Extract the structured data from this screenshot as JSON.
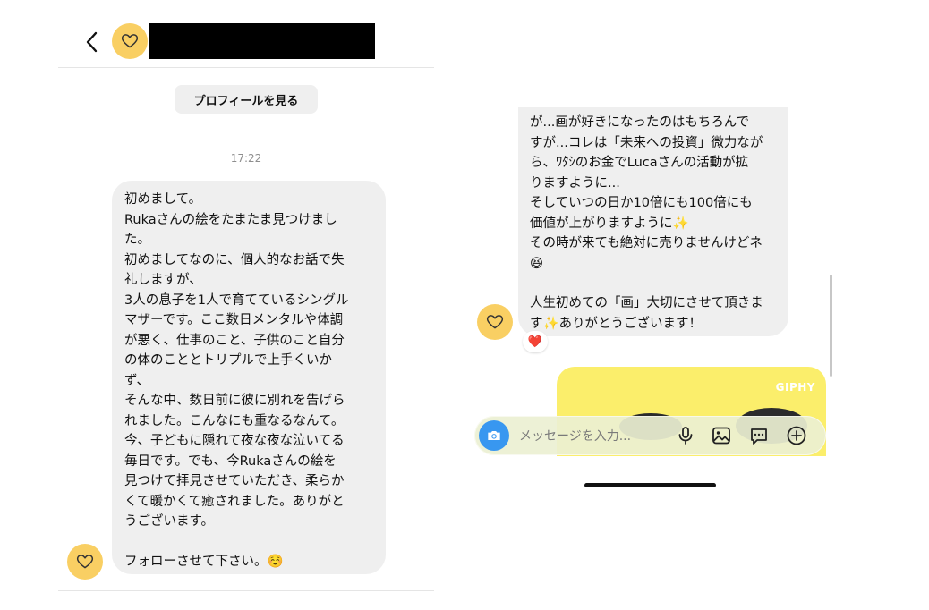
{
  "left_panel": {
    "profile_button_label": "プロフィールを見る",
    "timestamp": "17:22",
    "message_lines": [
      "初めまして。",
      "Rukaさんの絵をたまたま見つけまし\nた。",
      "初めましてなのに、個人的なお話で失\n礼しますが、",
      "3人の息子を1人で育てているシングル\nマザーです。ここ数日メンタルや体調\nが悪く、仕事のこと、子供のこと自分\nの体のこととトリプルで上手くいか\nず、",
      "そんな中、数日前に彼に別れを告げら\nれました。こんなにも重なるなんて。",
      "今、子どもに隠れて夜な夜な泣いてる\n毎日です。でも、今Rukaさんの絵を\n見つけて拝見させていただき、柔らか\nくて暖かくて癒されました。ありがと\nうございます。",
      "",
      "フォローさせて下さい。☺️"
    ]
  },
  "right_panel": {
    "message_lines": [
      "が...画が好きになったのはもちろんで\nすが...コレは「未来への投資」微力なが\nら、ﾜﾀｼのお金でLucaさんの活動が拡\nりますように...",
      "そしていつの日か10倍にも100倍にも\n価値が上がりますように✨",
      "その時が来ても絶対に売りませんけどネ\n😆",
      "",
      "人生初めての「画」大切にさせて頂きま\nす✨ありがとうございます！"
    ],
    "reaction": "❤️",
    "gif_label": "GIPHY",
    "composer_placeholder": "メッセージを入力..."
  },
  "colors": {
    "avatar": "#f9cf63",
    "bubble": "#efefef",
    "camera_button": "#3897f0",
    "gif_background": "#fbee6b"
  }
}
